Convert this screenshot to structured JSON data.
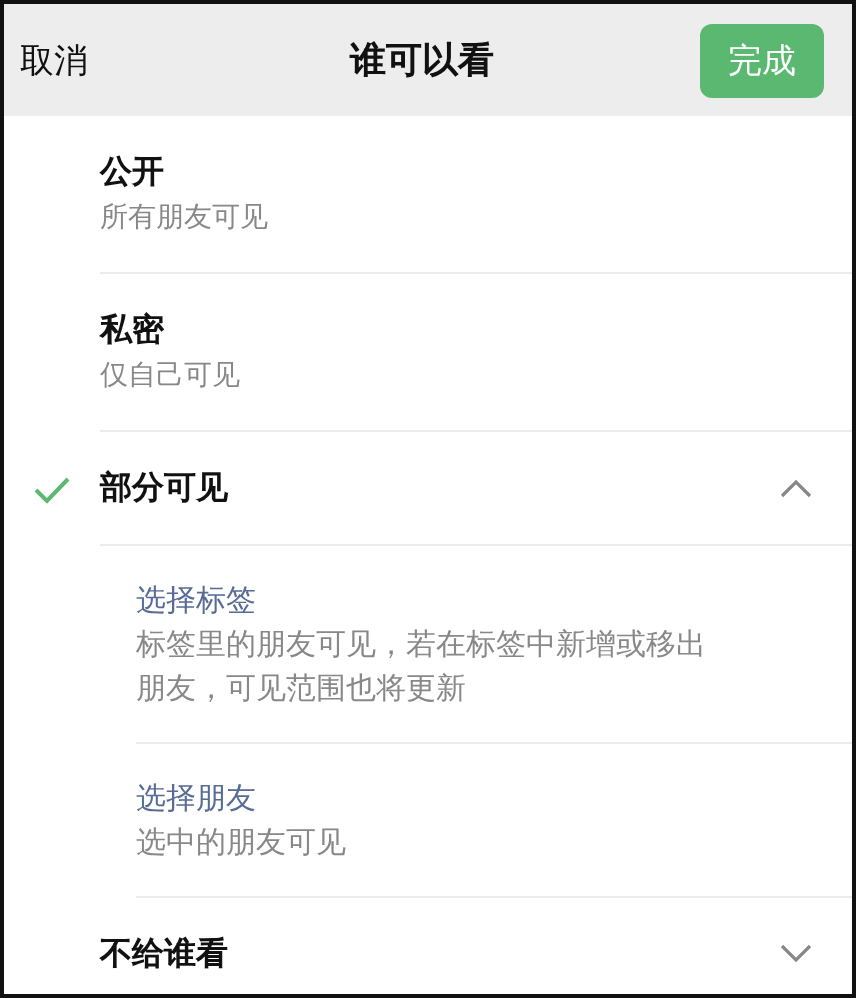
{
  "header": {
    "cancel": "取消",
    "title": "谁可以看",
    "done": "完成"
  },
  "options": [
    {
      "title": "公开",
      "subtitle": "所有朋友可见",
      "selected": false
    },
    {
      "title": "私密",
      "subtitle": "仅自己可见",
      "selected": false
    },
    {
      "title": "部分可见",
      "selected": true,
      "expanded": true,
      "children": [
        {
          "title": "选择标签",
          "subtitle": "标签里的朋友可见，若在标签中新增或移出朋友，可见范围也将更新"
        },
        {
          "title": "选择朋友",
          "subtitle": "选中的朋友可见"
        }
      ]
    },
    {
      "title": "不给谁看",
      "selected": false,
      "expanded": false
    }
  ]
}
